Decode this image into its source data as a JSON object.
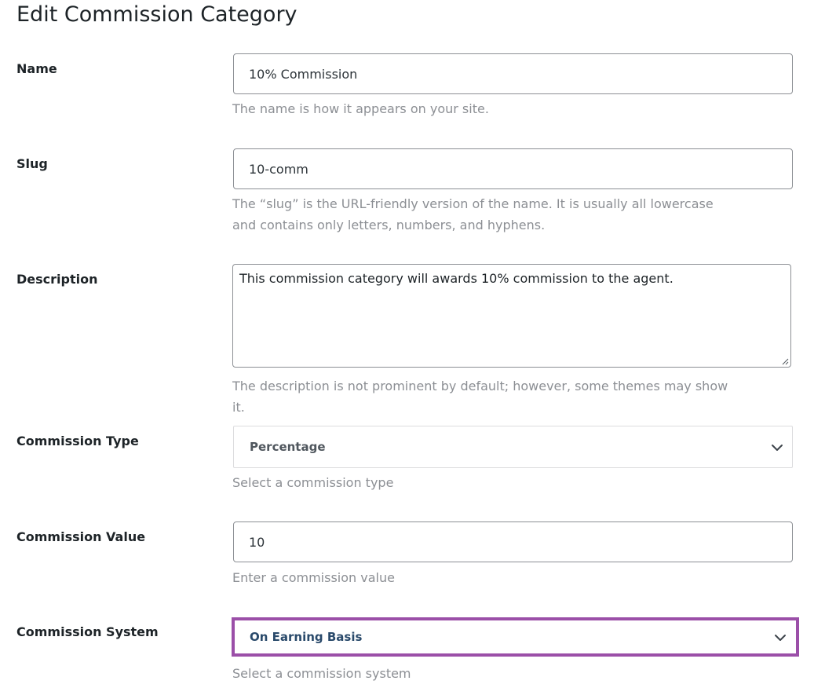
{
  "page": {
    "title": "Edit Commission Category"
  },
  "fields": {
    "name": {
      "label": "Name",
      "value": "10% Commission",
      "help": "The name is how it appears on your site."
    },
    "slug": {
      "label": "Slug",
      "value": "10-comm",
      "help": "The “slug” is the URL-friendly version of the name. It is usually all lowercase and contains only letters, numbers, and hyphens."
    },
    "description": {
      "label": "Description",
      "value": "This commission category will awards 10% commission to the agent.",
      "help": "The description is not prominent by default; however, some themes may show it."
    },
    "commission_type": {
      "label": "Commission Type",
      "selected": "Percentage",
      "help": "Select a commission type",
      "icon": "chevron-down-icon"
    },
    "commission_value": {
      "label": "Commission Value",
      "value": "10",
      "help": "Enter a commission value"
    },
    "commission_system": {
      "label": "Commission System",
      "selected": "On Earning Basis",
      "help": "Select a commission system",
      "icon": "chevron-down-icon",
      "highlight_color": "#9b4fa8"
    }
  }
}
